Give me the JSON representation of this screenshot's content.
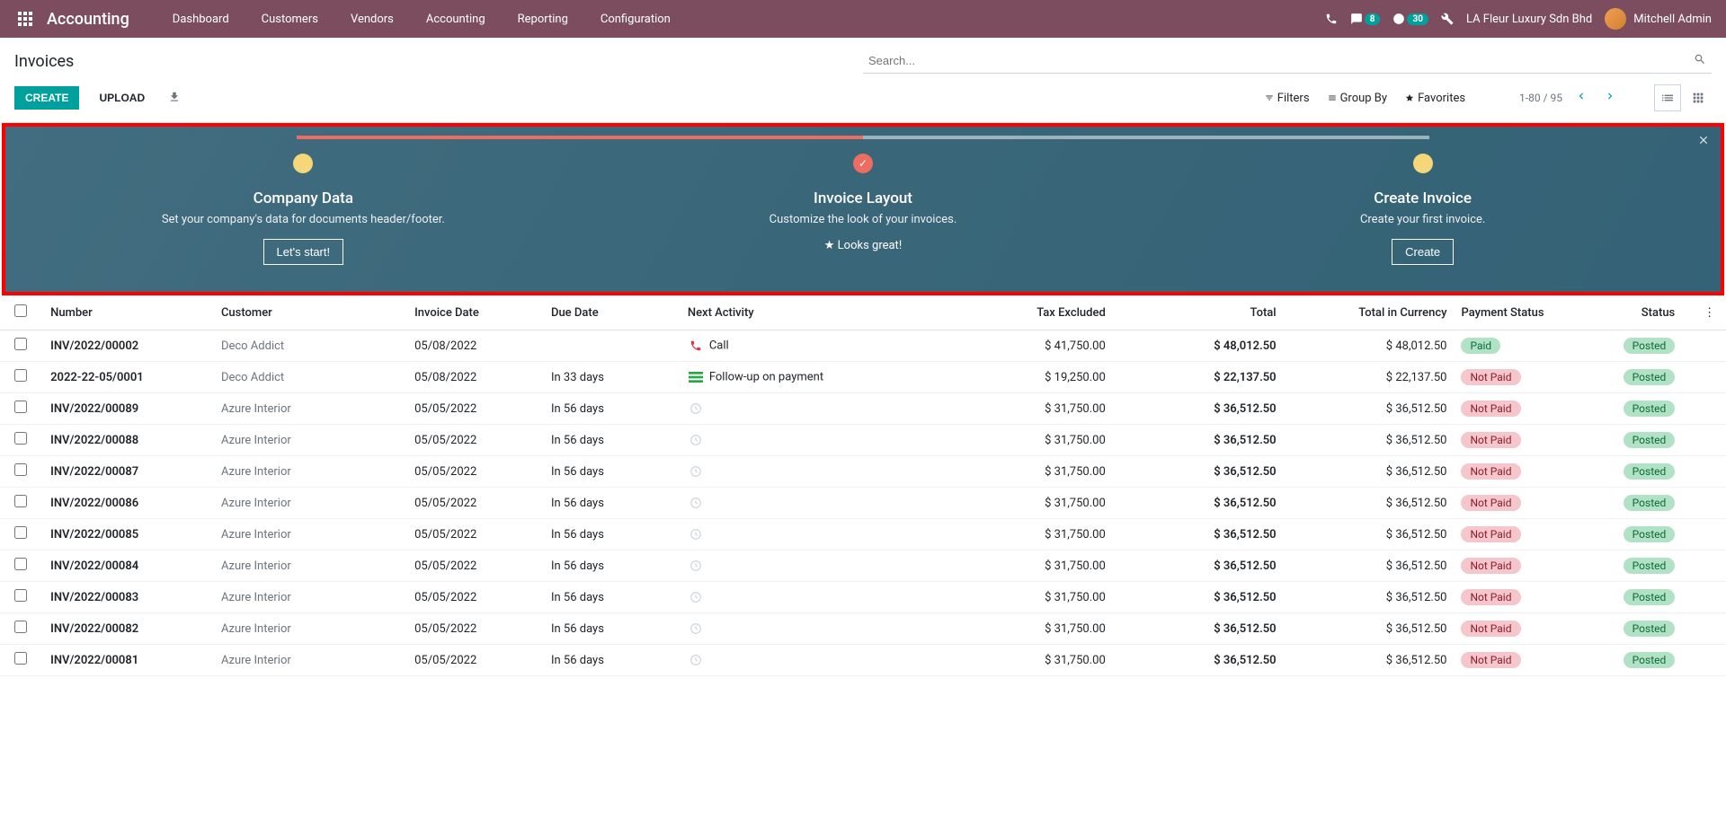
{
  "navbar": {
    "brand": "Accounting",
    "menu": [
      "Dashboard",
      "Customers",
      "Vendors",
      "Accounting",
      "Reporting",
      "Configuration"
    ],
    "chat_badge": "8",
    "activities_badge": "30",
    "company": "LA Fleur Luxury Sdn Bhd",
    "user": "Mitchell Admin"
  },
  "breadcrumb": "Invoices",
  "search": {
    "placeholder": "Search..."
  },
  "buttons": {
    "create": "CREATE",
    "upload": "UPLOAD"
  },
  "search_options": {
    "filters": "Filters",
    "group_by": "Group By",
    "favorites": "Favorites"
  },
  "pager": {
    "count": "1-80 / 95"
  },
  "onboarding": {
    "steps": [
      {
        "title": "Company Data",
        "desc": "Set your company's data for documents header/footer.",
        "action": "Let's start!",
        "dot": "yellow"
      },
      {
        "title": "Invoice Layout",
        "desc": "Customize the look of your invoices.",
        "action": "★ Looks great!",
        "dot": "red"
      },
      {
        "title": "Create Invoice",
        "desc": "Create your first invoice.",
        "action": "Create",
        "dot": "yellow"
      }
    ]
  },
  "table": {
    "headers": {
      "number": "Number",
      "customer": "Customer",
      "invoice_date": "Invoice Date",
      "due_date": "Due Date",
      "next_activity": "Next Activity",
      "tax_excluded": "Tax Excluded",
      "total": "Total",
      "total_in_currency": "Total in Currency",
      "payment_status": "Payment Status",
      "status": "Status"
    },
    "rows": [
      {
        "number": "INV/2022/00002",
        "customer": "Deco Addict",
        "invoice_date": "05/08/2022",
        "due_date": "",
        "activity": "Call",
        "activity_type": "call",
        "tax_excluded": "$ 41,750.00",
        "total": "$ 48,012.50",
        "tic": "$ 48,012.50",
        "pay": "Paid",
        "status": "Posted"
      },
      {
        "number": "2022-22-05/0001",
        "customer": "Deco Addict",
        "invoice_date": "05/08/2022",
        "due_date": "In 33 days",
        "activity": "Follow-up on payment",
        "activity_type": "follow",
        "tax_excluded": "$ 19,250.00",
        "total": "$ 22,137.50",
        "tic": "$ 22,137.50",
        "pay": "Not Paid",
        "status": "Posted"
      },
      {
        "number": "INV/2022/00089",
        "customer": "Azure Interior",
        "invoice_date": "05/05/2022",
        "due_date": "In 56 days",
        "activity": "",
        "activity_type": "clock",
        "tax_excluded": "$ 31,750.00",
        "total": "$ 36,512.50",
        "tic": "$ 36,512.50",
        "pay": "Not Paid",
        "status": "Posted"
      },
      {
        "number": "INV/2022/00088",
        "customer": "Azure Interior",
        "invoice_date": "05/05/2022",
        "due_date": "In 56 days",
        "activity": "",
        "activity_type": "clock",
        "tax_excluded": "$ 31,750.00",
        "total": "$ 36,512.50",
        "tic": "$ 36,512.50",
        "pay": "Not Paid",
        "status": "Posted"
      },
      {
        "number": "INV/2022/00087",
        "customer": "Azure Interior",
        "invoice_date": "05/05/2022",
        "due_date": "In 56 days",
        "activity": "",
        "activity_type": "clock",
        "tax_excluded": "$ 31,750.00",
        "total": "$ 36,512.50",
        "tic": "$ 36,512.50",
        "pay": "Not Paid",
        "status": "Posted"
      },
      {
        "number": "INV/2022/00086",
        "customer": "Azure Interior",
        "invoice_date": "05/05/2022",
        "due_date": "In 56 days",
        "activity": "",
        "activity_type": "clock",
        "tax_excluded": "$ 31,750.00",
        "total": "$ 36,512.50",
        "tic": "$ 36,512.50",
        "pay": "Not Paid",
        "status": "Posted"
      },
      {
        "number": "INV/2022/00085",
        "customer": "Azure Interior",
        "invoice_date": "05/05/2022",
        "due_date": "In 56 days",
        "activity": "",
        "activity_type": "clock",
        "tax_excluded": "$ 31,750.00",
        "total": "$ 36,512.50",
        "tic": "$ 36,512.50",
        "pay": "Not Paid",
        "status": "Posted"
      },
      {
        "number": "INV/2022/00084",
        "customer": "Azure Interior",
        "invoice_date": "05/05/2022",
        "due_date": "In 56 days",
        "activity": "",
        "activity_type": "clock",
        "tax_excluded": "$ 31,750.00",
        "total": "$ 36,512.50",
        "tic": "$ 36,512.50",
        "pay": "Not Paid",
        "status": "Posted"
      },
      {
        "number": "INV/2022/00083",
        "customer": "Azure Interior",
        "invoice_date": "05/05/2022",
        "due_date": "In 56 days",
        "activity": "",
        "activity_type": "clock",
        "tax_excluded": "$ 31,750.00",
        "total": "$ 36,512.50",
        "tic": "$ 36,512.50",
        "pay": "Not Paid",
        "status": "Posted"
      },
      {
        "number": "INV/2022/00082",
        "customer": "Azure Interior",
        "invoice_date": "05/05/2022",
        "due_date": "In 56 days",
        "activity": "",
        "activity_type": "clock",
        "tax_excluded": "$ 31,750.00",
        "total": "$ 36,512.50",
        "tic": "$ 36,512.50",
        "pay": "Not Paid",
        "status": "Posted"
      },
      {
        "number": "INV/2022/00081",
        "customer": "Azure Interior",
        "invoice_date": "05/05/2022",
        "due_date": "In 56 days",
        "activity": "",
        "activity_type": "clock",
        "tax_excluded": "$ 31,750.00",
        "total": "$ 36,512.50",
        "tic": "$ 36,512.50",
        "pay": "Not Paid",
        "status": "Posted"
      }
    ]
  }
}
